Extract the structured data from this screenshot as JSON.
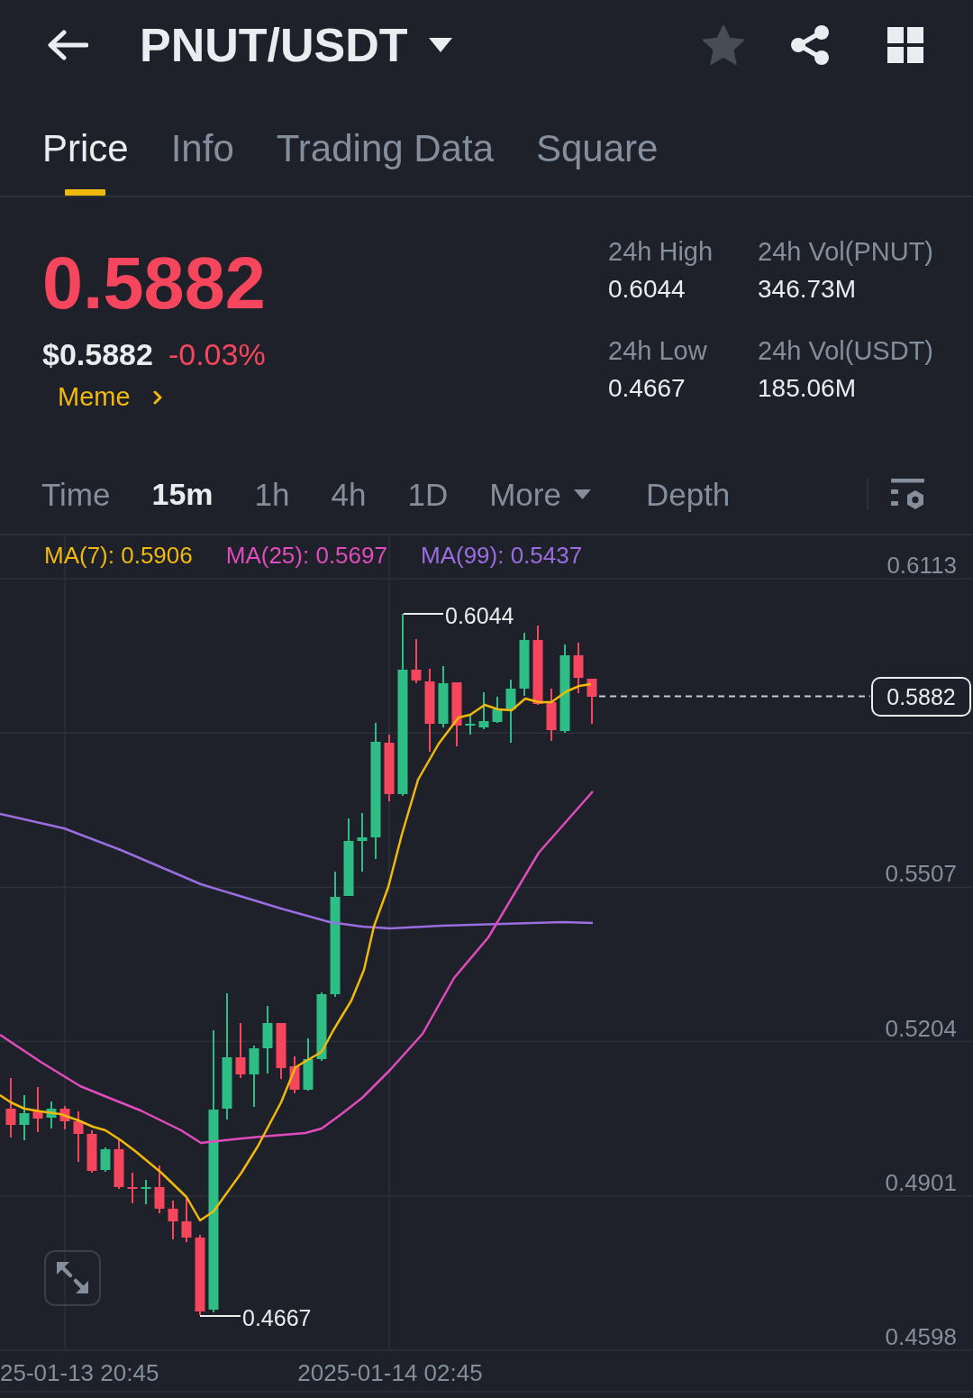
{
  "header": {
    "title": "PNUT/USDT",
    "favorite": false
  },
  "tabs": [
    {
      "label": "Price",
      "selected": true
    },
    {
      "label": "Info",
      "selected": false
    },
    {
      "label": "Trading Data",
      "selected": false
    },
    {
      "label": "Square",
      "selected": false
    }
  ],
  "ticker": {
    "last_price": "0.5882",
    "falling": true,
    "usd_price": "$0.5882",
    "change": "-0.03%",
    "category": "Meme"
  },
  "stats": [
    {
      "label": "24h High",
      "value": "0.6044"
    },
    {
      "label": "24h Vol(PNUT)",
      "value": "346.73M"
    },
    {
      "label": "24h Low",
      "value": "0.4667"
    },
    {
      "label": "24h Vol(USDT)",
      "value": "185.06M"
    }
  ],
  "intervals": [
    {
      "label": "Time",
      "kind": "option",
      "selected": false
    },
    {
      "label": "15m",
      "kind": "option",
      "selected": true
    },
    {
      "label": "1h",
      "kind": "option",
      "selected": false
    },
    {
      "label": "4h",
      "kind": "option",
      "selected": false
    },
    {
      "label": "1D",
      "kind": "option",
      "selected": false
    },
    {
      "label": "More",
      "kind": "dropdown",
      "selected": false
    },
    {
      "label": "Depth",
      "kind": "option",
      "selected": false
    }
  ],
  "chart": {
    "ma_legend": [
      {
        "label": "MA(7): 0.5906",
        "color": "#f0b90b"
      },
      {
        "label": "MA(25): 0.5697",
        "color": "#e04bbd"
      },
      {
        "label": "MA(99): 0.5437",
        "color": "#9a6ee0"
      }
    ],
    "y_axis_labels": [
      "0.6113",
      "0.5507",
      "0.5204",
      "0.4901",
      "0.4598"
    ],
    "x_axis_labels": [
      "25-01-13 20:45",
      "2025-01-14 02:45"
    ],
    "high_marker": "0.6044",
    "low_marker": "0.4667",
    "last_price_tag": "0.5882"
  }
}
